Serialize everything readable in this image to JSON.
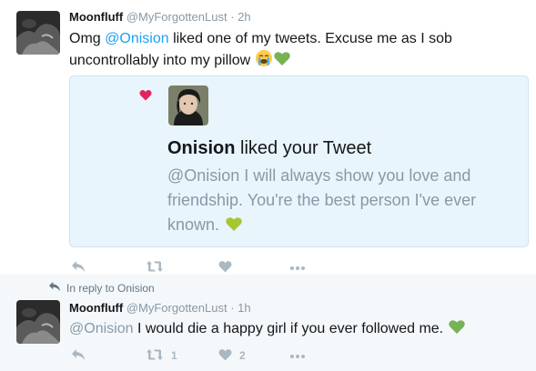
{
  "tweet1": {
    "name": "Moonfluff",
    "handle": "@MyForgottenLust",
    "dot": "·",
    "time": "2h",
    "text_before": "Omg ",
    "mention": "@Onision",
    "text_line1_after": " liked one of my tweets. Excuse me as I sob",
    "text_line2": "uncontrollably into my pillow",
    "emoji": [
      "loudly-crying-face",
      "green-heart"
    ],
    "quoted_notification": {
      "actor": "Onision",
      "action_text": " liked your Tweet",
      "quoted_text": "@Onision I will always show you love and friendship. You're the best person I've ever known.",
      "emoji": [
        "green-heart"
      ],
      "accent_color": "#e0245e"
    },
    "actions": {
      "reply_icon": "reply-icon",
      "retweet_icon": "retweet-icon",
      "like_icon": "heart-icon",
      "more_icon": "more-icon"
    }
  },
  "reply_context": {
    "label": "In reply to Onision",
    "icon": "reply-icon"
  },
  "tweet2": {
    "name": "Moonfluff",
    "handle": "@MyForgottenLust",
    "dot": "·",
    "time": "1h",
    "mention": "@Onision",
    "text_after": " I would die a happy girl if you ever followed me.",
    "emoji": [
      "green-heart"
    ],
    "actions": {
      "retweet_count": "1",
      "like_count": "2"
    }
  },
  "colors": {
    "link": "#1da1f2",
    "muted": "#8899a6",
    "card_bg": "#e8f5fd",
    "reply_bg": "#f5f8fa",
    "green_heart": "#77b255",
    "like_red": "#e0245e"
  }
}
